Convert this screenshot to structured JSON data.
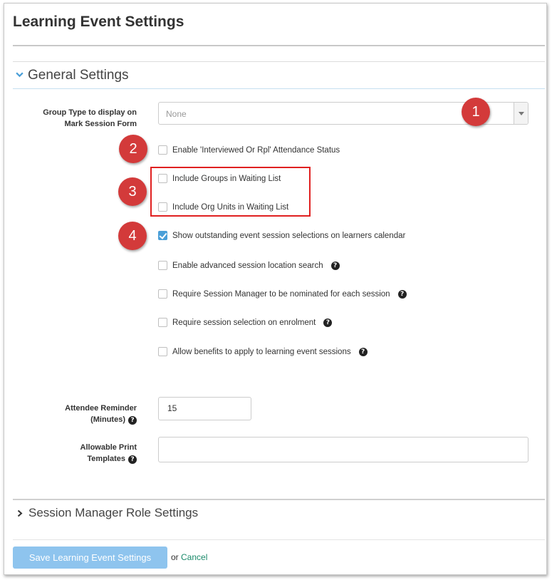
{
  "page_title": "Learning Event Settings",
  "general_section": {
    "title": "General Settings",
    "expanded": true
  },
  "group_type": {
    "label_line1": "Group Type to display on",
    "label_line2": "Mark Session Form",
    "value": "None"
  },
  "checkboxes": [
    {
      "label": "Enable 'Interviewed Or Rpl' Attendance Status",
      "checked": false,
      "help": false
    },
    {
      "label": "Include Groups in Waiting List",
      "checked": false,
      "help": false
    },
    {
      "label": "Include Org Units in Waiting List",
      "checked": false,
      "help": false
    },
    {
      "label": "Show outstanding event session selections on learners calendar",
      "checked": true,
      "help": false
    },
    {
      "label": "Enable advanced session location search",
      "checked": false,
      "help": true
    },
    {
      "label": "Require Session Manager to be nominated for each session",
      "checked": false,
      "help": true
    },
    {
      "label": "Require session selection on enrolment",
      "checked": false,
      "help": true
    },
    {
      "label": "Allow benefits to apply to learning event sessions",
      "checked": false,
      "help": true
    }
  ],
  "badges": [
    "1",
    "2",
    "3",
    "4"
  ],
  "attendee_reminder": {
    "label_line1": "Attendee Reminder",
    "label_line2": "(Minutes)",
    "value": "15"
  },
  "print_templates": {
    "label_line1": "Allowable Print",
    "label_line2": "Templates",
    "value": ""
  },
  "session_manager_section": {
    "title": "Session Manager Role Settings",
    "expanded": false
  },
  "footer": {
    "save_label": "Save Learning Event Settings",
    "or_text": "or",
    "cancel_label": "Cancel"
  },
  "colors": {
    "accent": "#4a9fd8",
    "save_button": "#8ec4ee",
    "badge": "#d33a3a",
    "highlight_box": "#e02020",
    "cancel_link": "#1a8a6a"
  }
}
